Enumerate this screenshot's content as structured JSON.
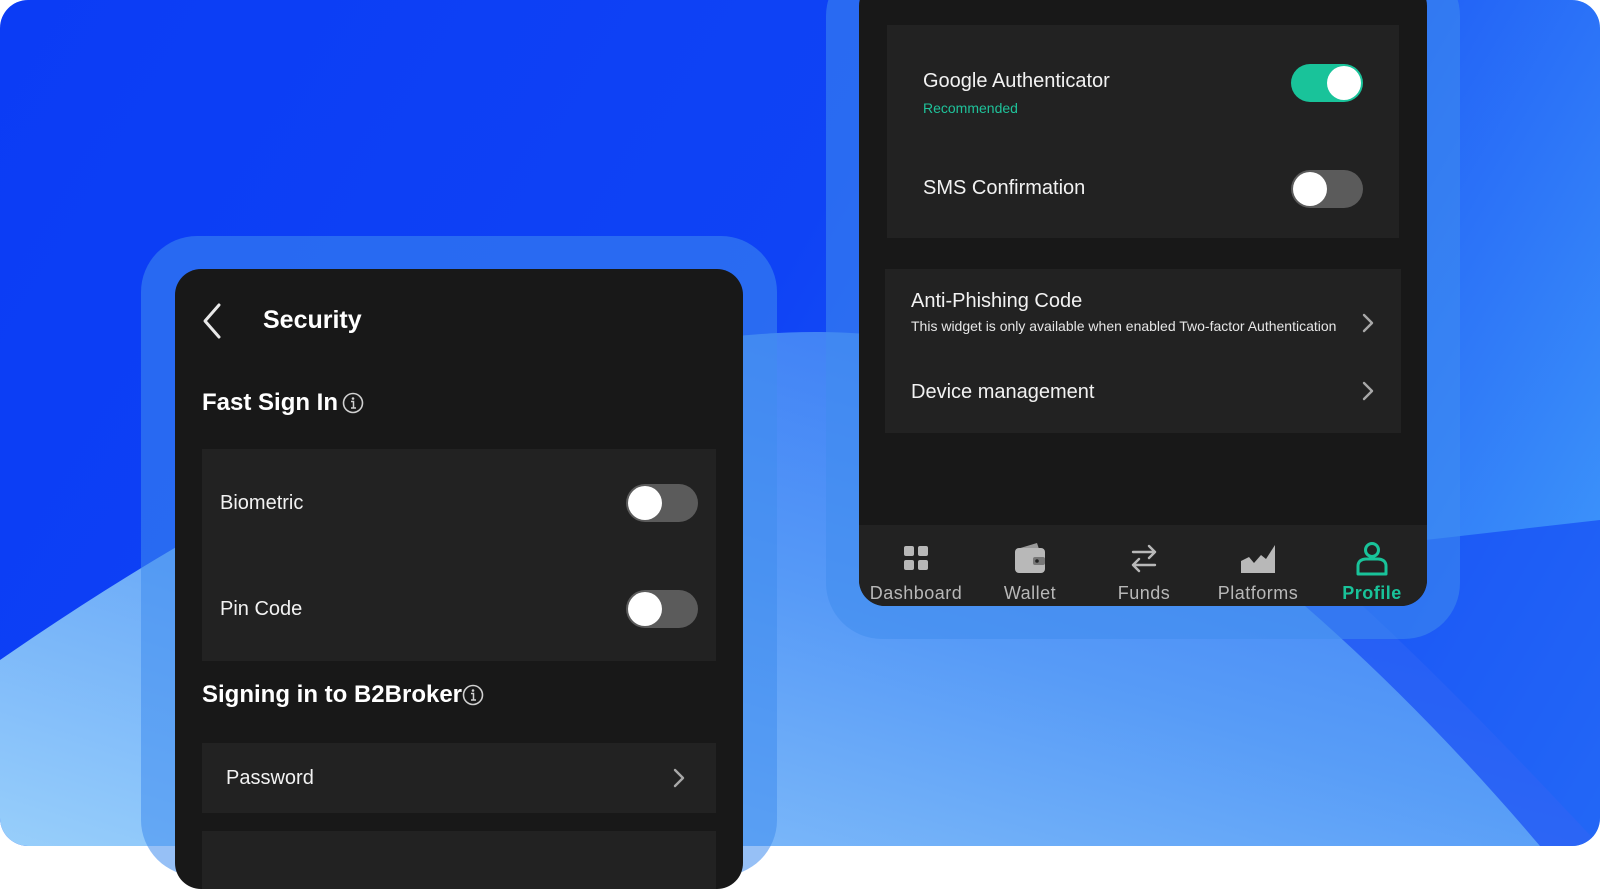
{
  "colors": {
    "accent_green": "#19c39a",
    "screen_bg": "#181818",
    "card_bg": "#222222",
    "background_blue": "#0f43f5"
  },
  "left_screen": {
    "title": "Security",
    "back_icon": "chevron-left-icon",
    "fast_sign_in": {
      "title": "Fast Sign In",
      "info_icon": "info-icon",
      "items": [
        {
          "label": "Biometric",
          "enabled": false
        },
        {
          "label": "Pin Code",
          "enabled": false
        }
      ]
    },
    "signing_in": {
      "title": "Signing in to B2Broker",
      "info_icon": "info-icon",
      "items": [
        {
          "label": "Password"
        }
      ]
    }
  },
  "right_screen": {
    "two_factor": [
      {
        "label": "Google Authenticator",
        "sublabel": "Recommended",
        "enabled": true
      },
      {
        "label": "SMS Confirmation",
        "enabled": false
      }
    ],
    "links": [
      {
        "label": "Anti-Phishing Code",
        "sublabel": "This widget is only available when enabled Two-factor Authentication"
      },
      {
        "label": "Device management"
      }
    ],
    "nav": [
      {
        "label": "Dashboard",
        "icon": "dashboard-grid-icon",
        "active": false
      },
      {
        "label": "Wallet",
        "icon": "wallet-icon",
        "active": false
      },
      {
        "label": "Funds",
        "icon": "transfer-arrows-icon",
        "active": false
      },
      {
        "label": "Platforms",
        "icon": "chart-area-icon",
        "active": false
      },
      {
        "label": "Profile",
        "icon": "profile-person-icon",
        "active": true
      }
    ]
  }
}
